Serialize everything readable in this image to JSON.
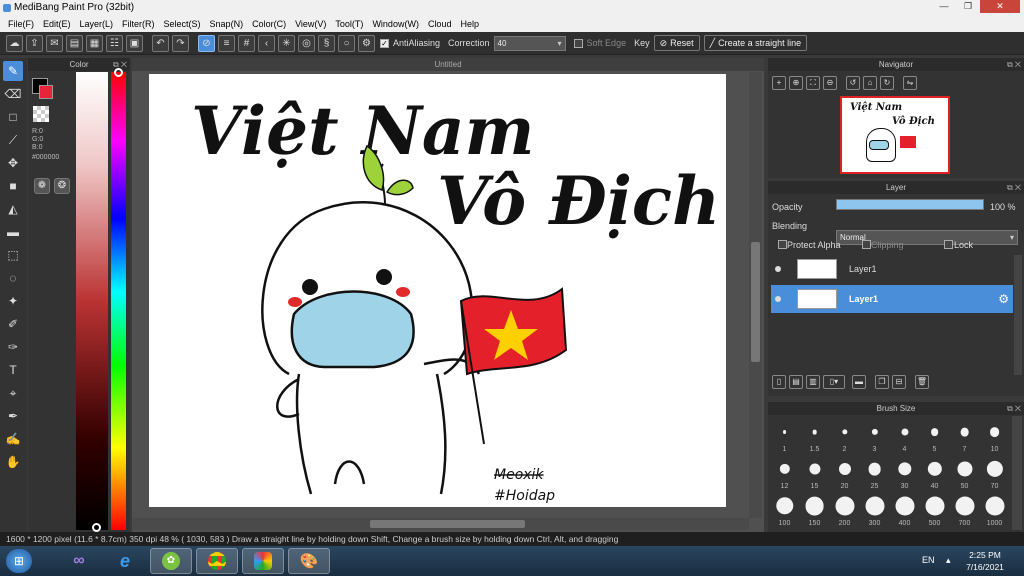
{
  "app": {
    "title": "MediBang Paint Pro (32bit)"
  },
  "window_buttons": {
    "minimize": "—",
    "restore": "❐",
    "close": "✕"
  },
  "menu": [
    "File(F)",
    "Edit(E)",
    "Layer(L)",
    "Filter(R)",
    "Select(S)",
    "Snap(N)",
    "Color(C)",
    "View(V)",
    "Tool(T)",
    "Window(W)",
    "Cloud",
    "Help"
  ],
  "toolbar": {
    "antialias_label": "AntiAliasing",
    "correction_label": "Correction",
    "correction_value": "40",
    "soft_edge_label": "Soft Edge",
    "key_label": "Key",
    "reset_label": "Reset",
    "straight_line_label": "Create a straight line"
  },
  "color_panel": {
    "title": "Color",
    "r": "R:0",
    "g": "G:0",
    "b": "B:0",
    "hex": "#000000",
    "fg": "#000000",
    "bg": "#e8233a"
  },
  "document": {
    "tab": "Untitled"
  },
  "artwork": {
    "line1": "Việt Nam",
    "line2": "Vô Địch",
    "sig1": "Meoxik",
    "sig2": "#Hoidap"
  },
  "navigator": {
    "title": "Navigator"
  },
  "layer_panel": {
    "title": "Layer",
    "opacity_label": "Opacity",
    "opacity_value": "100 %",
    "opacity_fraction": 1.0,
    "blending_label": "Blending",
    "blending_value": "Normal",
    "protect_alpha": "Protect Alpha",
    "clipping": "Clipping",
    "lock": "Lock",
    "layers": [
      {
        "name": "Layer1",
        "selected": false
      },
      {
        "name": "Layer1",
        "selected": true
      }
    ]
  },
  "brush_panel": {
    "title": "Brush Size",
    "sizes": [
      "1",
      "1.5",
      "2",
      "3",
      "4",
      "5",
      "7",
      "10",
      "12",
      "15",
      "20",
      "25",
      "30",
      "40",
      "50",
      "70",
      "100",
      "150",
      "200",
      "300",
      "400",
      "500",
      "700",
      "1000"
    ]
  },
  "status": {
    "size": "1600 * 1200 pixel",
    "cm": "(11.6 * 8.7cm)",
    "dpi": "350 dpi",
    "zoom": "48 %",
    "coords": "( 1030, 583 )",
    "hint": "Draw a straight line by holding down Shift, Change a brush size by holding down Ctrl, Alt, and dragging"
  },
  "taskbar": {
    "lang": "EN",
    "time": "2:25 PM",
    "date": "7/16/2021"
  }
}
